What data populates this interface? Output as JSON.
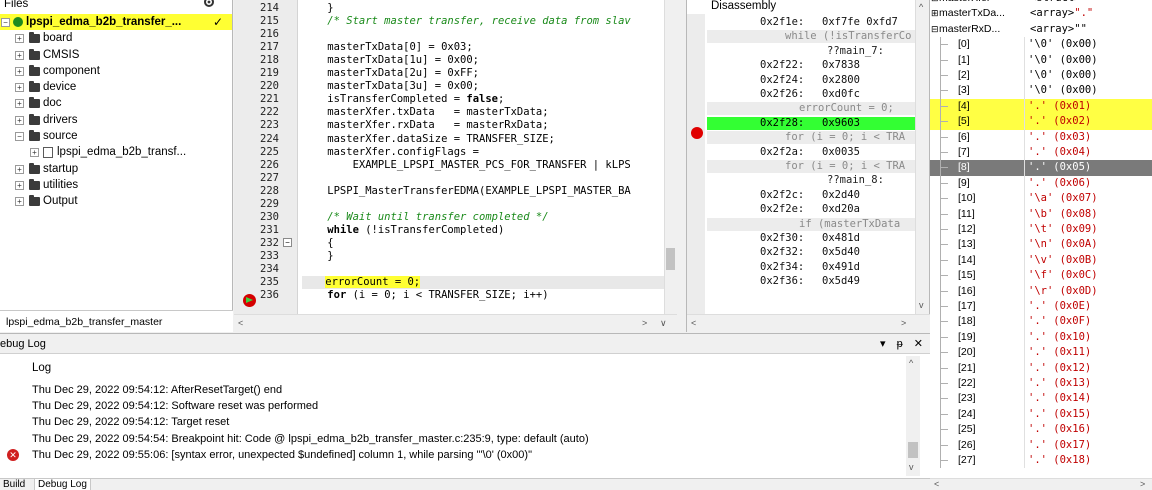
{
  "files": {
    "title": "Files",
    "items": [
      {
        "label": "lpspi_edma_b2b_transfer_...",
        "kind": "project"
      },
      {
        "label": "board",
        "kind": "folder"
      },
      {
        "label": "CMSIS",
        "kind": "folder"
      },
      {
        "label": "component",
        "kind": "folder"
      },
      {
        "label": "device",
        "kind": "folder"
      },
      {
        "label": "doc",
        "kind": "folder"
      },
      {
        "label": "drivers",
        "kind": "folder"
      },
      {
        "label": "source",
        "kind": "folder"
      },
      {
        "label": "lpspi_edma_b2b_transf...",
        "kind": "file"
      },
      {
        "label": "startup",
        "kind": "folder"
      },
      {
        "label": "utilities",
        "kind": "folder"
      },
      {
        "label": "Output",
        "kind": "folder"
      }
    ],
    "bottom_tab": "lpspi_edma_b2b_transfer_master"
  },
  "editor": {
    "lines": [
      {
        "n": "214",
        "text": "    }"
      },
      {
        "n": "215",
        "text": "    /* Start master transfer, receive data from slav"
      },
      {
        "n": "216",
        "text": ""
      },
      {
        "n": "217",
        "text": "    masterTxData[0] = 0x03;"
      },
      {
        "n": "218",
        "text": "    masterTxData[1u] = 0x00;"
      },
      {
        "n": "219",
        "text": "    masterTxData[2u] = 0xFF;"
      },
      {
        "n": "220",
        "text": "    masterTxData[3u] = 0x00;"
      },
      {
        "n": "221",
        "text": "    isTransferCompleted = false;"
      },
      {
        "n": "222",
        "text": "    masterXfer.txData   = masterTxData;"
      },
      {
        "n": "223",
        "text": "    masterXfer.rxData   = masterRxData;"
      },
      {
        "n": "224",
        "text": "    masterXfer.dataSize = TRANSFER_SIZE;"
      },
      {
        "n": "225",
        "text": "    masterXfer.configFlags ="
      },
      {
        "n": "226",
        "text": "        EXAMPLE_LPSPI_MASTER_PCS_FOR_TRANSFER | kLPS"
      },
      {
        "n": "227",
        "text": ""
      },
      {
        "n": "228",
        "text": "    LPSPI_MasterTransferEDMA(EXAMPLE_LPSPI_MASTER_BA"
      },
      {
        "n": "229",
        "text": ""
      },
      {
        "n": "230",
        "text": "    /* Wait until transfer completed */"
      },
      {
        "n": "231",
        "text": "    while (!isTransferCompleted)"
      },
      {
        "n": "232",
        "text": "    {"
      },
      {
        "n": "233",
        "text": "    }"
      },
      {
        "n": "234",
        "text": ""
      },
      {
        "n": "235",
        "text": "    errorCount = 0;"
      },
      {
        "n": "236",
        "text": "    for (i = 0; i < TRANSFER_SIZE; i++)"
      }
    ]
  },
  "disasm": {
    "title": "Disassembly",
    "rows": [
      {
        "kind": "code",
        "addr": "0x2f1e:",
        "op": "0xf7fe 0xfd7"
      },
      {
        "kind": "src",
        "text": "while (!isTransferCo"
      },
      {
        "kind": "lbl",
        "text": "??main_7:"
      },
      {
        "kind": "code",
        "addr": "0x2f22:",
        "op": "0x7838"
      },
      {
        "kind": "code",
        "addr": "0x2f24:",
        "op": "0x2800"
      },
      {
        "kind": "code",
        "addr": "0x2f26:",
        "op": "0xd0fc"
      },
      {
        "kind": "src",
        "text": "errorCount = 0;"
      },
      {
        "kind": "cur",
        "addr": "0x2f28:",
        "op": "0x9603"
      },
      {
        "kind": "src",
        "text": "for (i = 0; i < TRA"
      },
      {
        "kind": "code",
        "addr": "0x2f2a:",
        "op": "0x0035"
      },
      {
        "kind": "src",
        "text": "for (i = 0; i < TRA"
      },
      {
        "kind": "lbl",
        "text": "??main_8:"
      },
      {
        "kind": "code",
        "addr": "0x2f2c:",
        "op": "0x2d40"
      },
      {
        "kind": "code",
        "addr": "0x2f2e:",
        "op": "0xd20a"
      },
      {
        "kind": "src",
        "text": "if (masterTxData"
      },
      {
        "kind": "code",
        "addr": "0x2f30:",
        "op": "0x481d"
      },
      {
        "kind": "code",
        "addr": "0x2f32:",
        "op": "0x5d40"
      },
      {
        "kind": "code",
        "addr": "0x2f34:",
        "op": "0x491d"
      },
      {
        "kind": "code",
        "addr": "0x2f36:",
        "op": "0x5d49"
      }
    ]
  },
  "watch": {
    "top": [
      {
        "name": "masterXfer",
        "value": "<struct>",
        "red": ""
      },
      {
        "name": "masterTxDa...",
        "value": "<array>",
        "red": "\".\""
      },
      {
        "name": "masterRxD...",
        "value": "<array>\"\"",
        "red": ""
      }
    ],
    "items": [
      {
        "name": "[0]",
        "value": "'\\0' (0x00)",
        "red": false
      },
      {
        "name": "[1]",
        "value": "'\\0' (0x00)",
        "red": false
      },
      {
        "name": "[2]",
        "value": "'\\0' (0x00)",
        "red": false
      },
      {
        "name": "[3]",
        "value": "'\\0' (0x00)",
        "red": false
      },
      {
        "name": "[4]",
        "value": "'.' (0x01)",
        "red": true
      },
      {
        "name": "[5]",
        "value": "'.' (0x02)",
        "red": true
      },
      {
        "name": "[6]",
        "value": "'.' (0x03)",
        "red": true
      },
      {
        "name": "[7]",
        "value": "'.' (0x04)",
        "red": true
      },
      {
        "name": "[8]",
        "value": "'.' (0x05)",
        "red": true
      },
      {
        "name": "[9]",
        "value": "'.' (0x06)",
        "red": true
      },
      {
        "name": "[10]",
        "value": "'\\a' (0x07)",
        "red": true
      },
      {
        "name": "[11]",
        "value": "'\\b' (0x08)",
        "red": true
      },
      {
        "name": "[12]",
        "value": "'\\t' (0x09)",
        "red": true
      },
      {
        "name": "[13]",
        "value": "'\\n' (0x0A)",
        "red": true
      },
      {
        "name": "[14]",
        "value": "'\\v' (0x0B)",
        "red": true
      },
      {
        "name": "[15]",
        "value": "'\\f' (0x0C)",
        "red": true
      },
      {
        "name": "[16]",
        "value": "'\\r' (0x0D)",
        "red": true
      },
      {
        "name": "[17]",
        "value": "'.' (0x0E)",
        "red": true
      },
      {
        "name": "[18]",
        "value": "'.' (0x0F)",
        "red": true
      },
      {
        "name": "[19]",
        "value": "'.' (0x10)",
        "red": true
      },
      {
        "name": "[20]",
        "value": "'.' (0x11)",
        "red": true
      },
      {
        "name": "[21]",
        "value": "'.' (0x12)",
        "red": true
      },
      {
        "name": "[22]",
        "value": "'.' (0x13)",
        "red": true
      },
      {
        "name": "[23]",
        "value": "'.' (0x14)",
        "red": true
      },
      {
        "name": "[24]",
        "value": "'.' (0x15)",
        "red": true
      },
      {
        "name": "[25]",
        "value": "'.' (0x16)",
        "red": true
      },
      {
        "name": "[26]",
        "value": "'.' (0x17)",
        "red": true
      },
      {
        "name": "[27]",
        "value": "'.' (0x18)",
        "red": true
      }
    ]
  },
  "debug": {
    "title": "ebug Log",
    "buttons": "▾ ᵽ ✕",
    "column": "Log",
    "lines": [
      "Thu Dec 29, 2022 09:54:12: AfterResetTarget() end",
      "Thu Dec 29, 2022 09:54:12: Software reset was performed",
      "Thu Dec 29, 2022 09:54:12: Target reset",
      "Thu Dec 29, 2022 09:54:54: Breakpoint hit: Code @ lpspi_edma_b2b_transfer_master.c:235:9, type: default (auto)",
      "Thu Dec 29, 2022 09:55:06: [syntax error, unexpected $undefined] column 1, while parsing \"'\\0' (0x00)\""
    ]
  },
  "tabs": [
    "Build",
    "Debug Log"
  ],
  "colors": {
    "highlight": "#ffff33",
    "current_line": "#33ff33",
    "breakpoint": "#e00000",
    "watch_value": "#c00000"
  }
}
